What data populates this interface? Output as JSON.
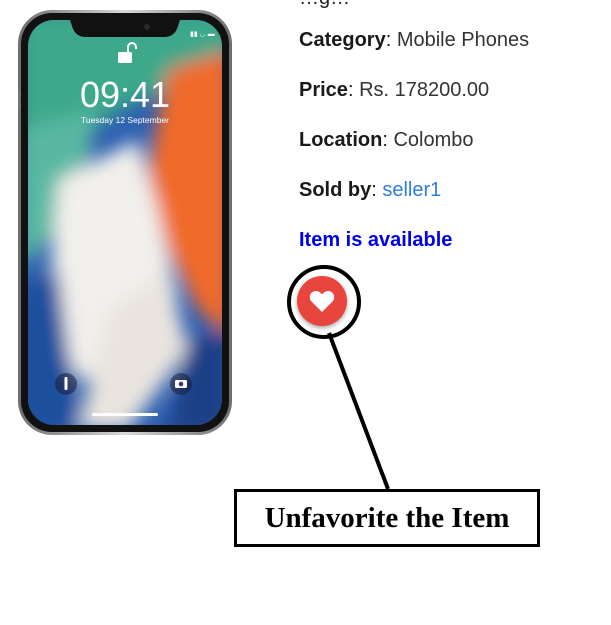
{
  "product": {
    "image_alt_icon": "phone-image",
    "lockscreen": {
      "time": "09:41",
      "date": "Tuesday 12 September"
    },
    "heading_partial": "…g…",
    "details": [
      {
        "label": "Category",
        "value": "Mobile Phones"
      },
      {
        "label": "Price",
        "value": "Rs. 178200.00"
      },
      {
        "label": "Location",
        "value": "Colombo"
      }
    ],
    "sold_by": {
      "label": "Sold by",
      "seller": "seller1"
    },
    "separator": ":",
    "availability": "Item is available",
    "favorite_icon": "heart-icon"
  },
  "annotation": {
    "text": "Unfavorite the Item"
  },
  "colors": {
    "favorite_button": "#e8453c",
    "availability_text": "#0000ee",
    "seller_link": "#2f7de1"
  }
}
